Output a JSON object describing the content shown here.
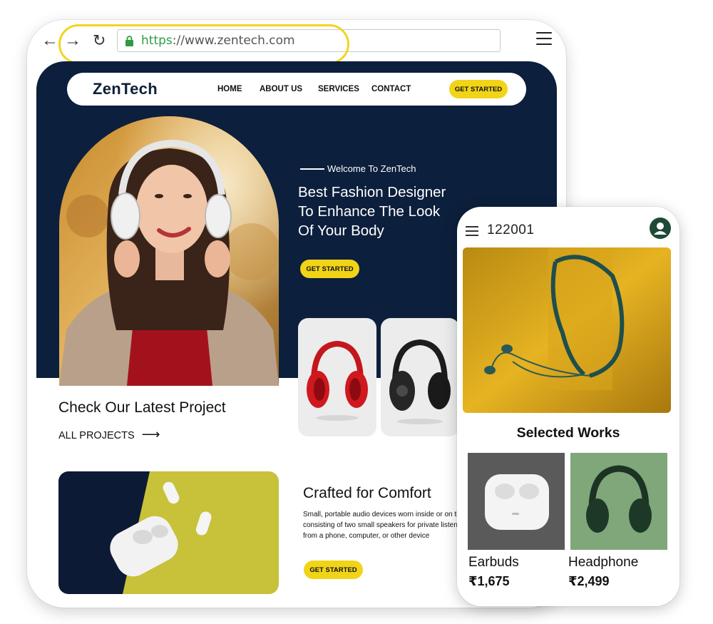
{
  "browser": {
    "url_scheme": "https",
    "url_rest": "://www.zentech.com"
  },
  "site": {
    "logo": "ZenTech",
    "nav": [
      "HOME",
      "ABOUT US",
      "SERVICES",
      "CONTACT"
    ],
    "nav_cta": "GET STARTED",
    "hero": {
      "tagline": "Welcome To ZenTech",
      "title_lines": [
        "Best Fashion Designer",
        "To Enhance The Look",
        "Of Your Body"
      ],
      "cta": "GET STARTED"
    },
    "projects": {
      "title": "Check Our Latest Project",
      "link": "ALL PROJECTS"
    },
    "feature": {
      "title": "Crafted for Comfort",
      "desc_lines": [
        "Small, portable audio devices worn inside or on the ear,",
        "consisting of two small speakers for private listening",
        "from a phone, computer, or other device"
      ],
      "cta": "GET STARTED"
    }
  },
  "mobile": {
    "pincode": "122001",
    "section_title": "Selected Works",
    "items": [
      {
        "name": "Earbuds",
        "price": "₹1,675"
      },
      {
        "name": "Headphone",
        "price": "₹2,499"
      }
    ]
  },
  "colors": {
    "navy": "#0c1f3c",
    "accent_yellow": "#f1d417",
    "url_green": "#2e9b44"
  }
}
